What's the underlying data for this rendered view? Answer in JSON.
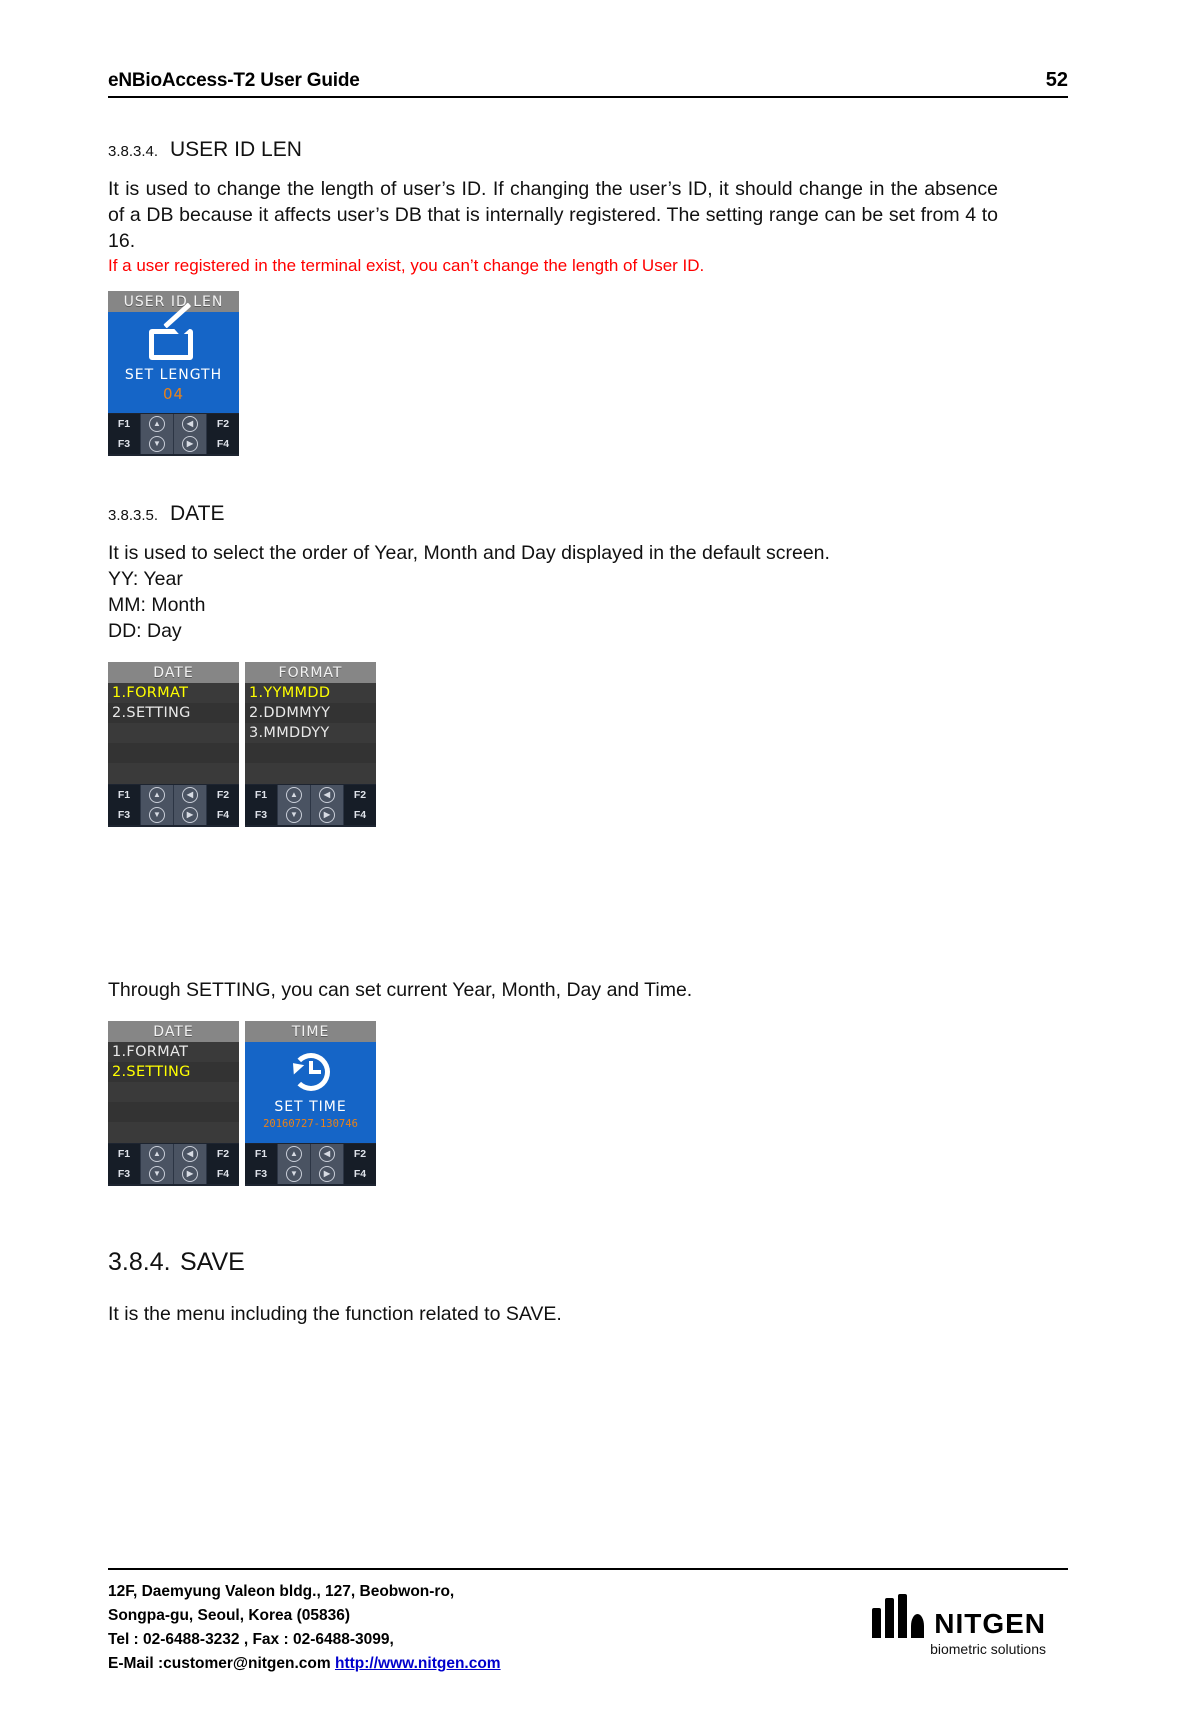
{
  "header": {
    "title": "eNBioAccess-T2 User Guide",
    "page_number": "52"
  },
  "sections": {
    "user_id_len": {
      "number": "3.8.3.4.",
      "title": "USER ID LEN",
      "paragraph": "It is used to change the length of user’s ID. If changing the user’s ID, it should change in the absence of a DB because it affects user’s DB that is internally registered. The setting range can be set from 4 to 16.",
      "warning": "If a user registered in the terminal exist, you can’t change the length of User ID."
    },
    "date": {
      "number": "3.8.3.5.",
      "title": "DATE",
      "paragraph": "It is used to select the order of Year, Month and Day displayed in the default screen.",
      "legend": [
        "YY: Year",
        "MM: Month",
        "DD: Day"
      ],
      "setting_text": "Through SETTING, you can set current Year, Month, Day and Time."
    },
    "save": {
      "number": "3.8.4.",
      "title": "SAVE",
      "paragraph": "It is the menu including the function related to SAVE."
    }
  },
  "device_shots": {
    "user_id_len": {
      "title": "USER ID LEN",
      "icon": "edit-pencil-icon",
      "caption": "SET LENGTH",
      "value": "04",
      "keys_row1": [
        "F1",
        "up-arrow-icon",
        "left-arrow-icon",
        "F2"
      ],
      "keys_row2": [
        "F3",
        "down-arrow-icon",
        "right-arrow-icon",
        "F4"
      ]
    },
    "date_menu": {
      "title": "DATE",
      "rows": [
        "1.FORMAT",
        "2.SETTING",
        "",
        ""
      ],
      "selected_index": 0,
      "keys_row1": [
        "F1",
        "up-arrow-icon",
        "left-arrow-icon",
        "F2"
      ],
      "keys_row2": [
        "F3",
        "down-arrow-icon",
        "right-arrow-icon",
        "F4"
      ]
    },
    "format_menu": {
      "title": "FORMAT",
      "rows": [
        "1.YYMMDD",
        "2.DDMMYY",
        "3.MMDDYY",
        ""
      ],
      "selected_index": 0,
      "keys_row1": [
        "F1",
        "up-arrow-icon",
        "left-arrow-icon",
        "F2"
      ],
      "keys_row2": [
        "F3",
        "down-arrow-icon",
        "right-arrow-icon",
        "F4"
      ]
    },
    "date_menu_setting": {
      "title": "DATE",
      "rows": [
        "1.FORMAT",
        "2.SETTING",
        "",
        ""
      ],
      "selected_index": 1,
      "keys_row1": [
        "F1",
        "up-arrow-icon",
        "left-arrow-icon",
        "F2"
      ],
      "keys_row2": [
        "F3",
        "down-arrow-icon",
        "right-arrow-icon",
        "F4"
      ]
    },
    "time_screen": {
      "title": "TIME",
      "icon": "clock-icon",
      "caption": "SET TIME",
      "value": "20160727-130746",
      "keys_row1": [
        "F1",
        "up-arrow-icon",
        "left-arrow-icon",
        "F2"
      ],
      "keys_row2": [
        "F3",
        "down-arrow-icon",
        "right-arrow-icon",
        "F4"
      ]
    }
  },
  "footer": {
    "line1": "12F, Daemyung Valeon bldg., 127, Beobwon-ro,",
    "line2": "Songpa-gu, Seoul, Korea (05836)",
    "line3": "Tel : 02-6488-3232 , Fax : 02-6488-3099,",
    "line4_label": "E-Mail :customer@nitgen.com ",
    "line4_link": "http://www.nitgen.com",
    "logo_text": "NITGEN",
    "logo_sub": "biometric solutions"
  },
  "colors": {
    "warning_red": "#ff0000",
    "screen_blue": "#1565c7",
    "value_orange": "#e8821a",
    "selected_yellow": "#ffff00",
    "link_blue": "#0000cc"
  }
}
